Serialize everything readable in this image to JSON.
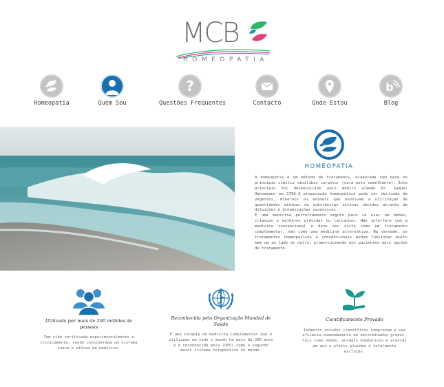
{
  "brand": {
    "name": "MCB",
    "subtitle": "HOMEOPATIA",
    "colors": {
      "primary": "#1a6fae",
      "leaf_green": "#2db36a",
      "leaf_pink": "#e0437a",
      "leaf_teal": "#1c8fb8",
      "icon_gray": "#c4c4c4"
    }
  },
  "nav": {
    "items": [
      {
        "label": "Homeopatia",
        "icon": "leaves-icon",
        "active": false
      },
      {
        "label": "Quem Sou",
        "icon": "person-icon",
        "active": true
      },
      {
        "label": "Questões Frequentes",
        "icon": "question-icon",
        "active": false
      },
      {
        "label": "Contacto",
        "icon": "envelope-icon",
        "active": false
      },
      {
        "label": "Onde Estou",
        "icon": "map-pin-icon",
        "active": false
      },
      {
        "label": "Blog",
        "icon": "blog-icon",
        "active": false
      }
    ]
  },
  "hero": {
    "icon": "ocean-wave-image"
  },
  "homeopatia": {
    "title": "HOMEOPATIA",
    "paragraph1": "A homeopatia é um método de tratamento, elaborada com base no princípio similia similibus curantur (cura pelo semelhante). Este princípio foi desenvolvido pelo médico alemão Dr. Samuel Hahnemann em 1796.A preparação homeopática pode ser derivada de vegetais, minerais ou animais que envolvam a utilização de quantidades mínimas de substâncias activas obtidas através de diluições e dinamizações sucessivas.",
    "paragraph2": "É uma medicina perfeitamente segura para se usar em bebés, crianças e mulheres grávidas ou lactantes. Não interfere com a medicina convencional e deve ser vista como um tratamento complementar, não como uma medicina alternativa. Na verdade, os tratamentos homeopáticos e convencionais podem funcionar muito bem um ao lado do outro, proporcionando aos pacientes mais opções de tratamento."
  },
  "features": [
    {
      "icon": "group-people-icon",
      "title": "Utilizada por mais de 200 milhões de pessoas",
      "text": "Tem sido verificada experimentalmente e clinicamente, sendo considerada um sistema suave e eficaz de medicina."
    },
    {
      "icon": "who-emblem-icon",
      "title": "Reconhecida pela Organização Mundial de Saúde",
      "text": "É uma terapia de medicina complementar que é utilizada em todo o mundo há mais de 200 anos e é reconhecida pela (OMS) como o segundo maior sistema terapêutico no mundo."
    },
    {
      "icon": "sprout-hand-icon",
      "title": "Cientificamente Provado",
      "text": "Inúmeros estudos científicos comprovam a sua eficácia,nomeadamente em determinados grupos, tais como bebés, animais domésticos e plantas em que o efeito placebo é totalmente excluído."
    }
  ]
}
